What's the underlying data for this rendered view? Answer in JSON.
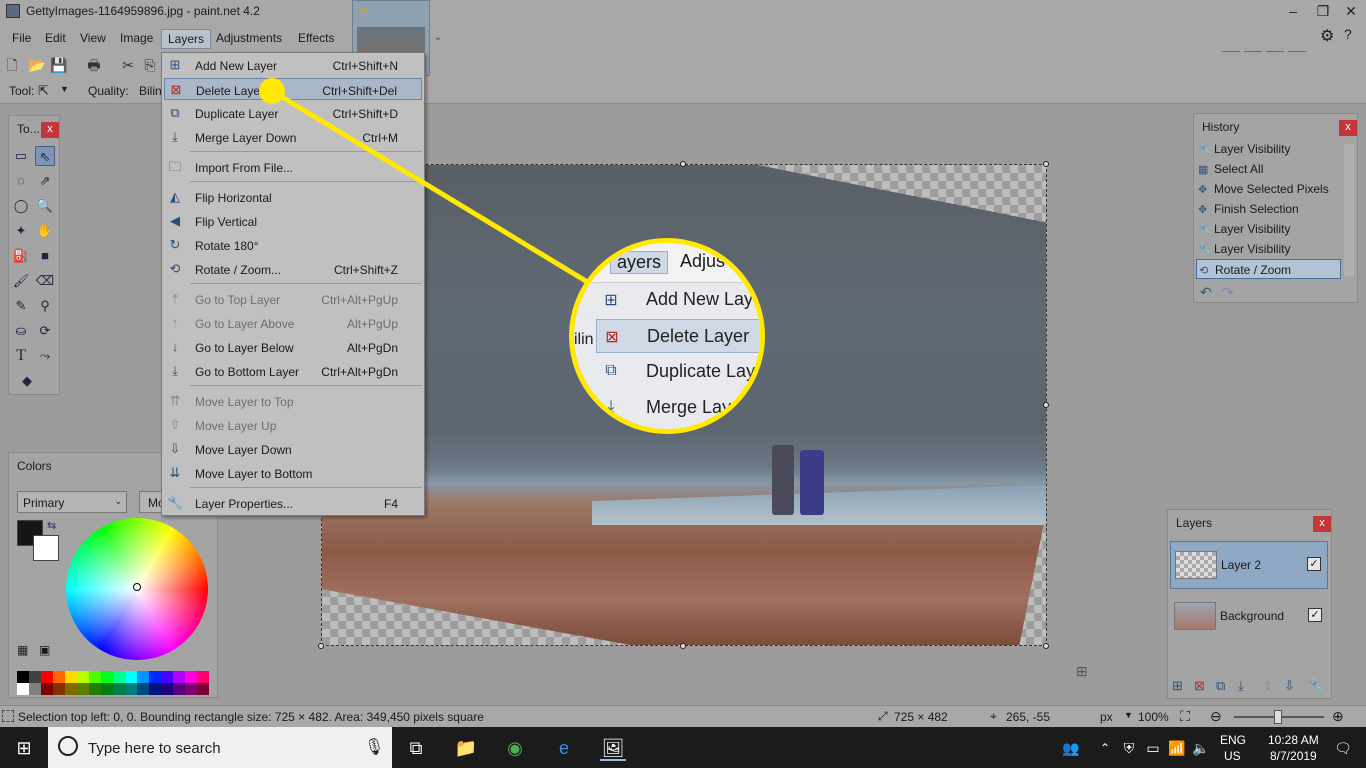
{
  "window": {
    "title": "GettyImages-1164959896.jpg - paint.net 4.2",
    "minimize": "–",
    "maximize": "❐",
    "close": "✕"
  },
  "menubar": {
    "items": [
      "File",
      "Edit",
      "View",
      "Image",
      "Layers",
      "Adjustments",
      "Effects"
    ],
    "active": "Layers"
  },
  "toolbar": {
    "tool_label": "Tool:",
    "quality_label": "Quality:",
    "quality_value": "Bilin"
  },
  "layers_menu": [
    {
      "label": "Add New Layer",
      "shortcut": "Ctrl+Shift+N",
      "enabled": true
    },
    {
      "label": "Delete Layer",
      "shortcut": "Ctrl+Shift+Del",
      "enabled": true,
      "highlighted": true
    },
    {
      "label": "Duplicate Layer",
      "shortcut": "Ctrl+Shift+D",
      "enabled": true
    },
    {
      "label": "Merge Layer Down",
      "shortcut": "Ctrl+M",
      "enabled": true
    },
    {
      "label": "Import From File...",
      "shortcut": "",
      "enabled": true
    },
    {
      "label": "Flip Horizontal",
      "shortcut": "",
      "enabled": true
    },
    {
      "label": "Flip Vertical",
      "shortcut": "",
      "enabled": true
    },
    {
      "label": "Rotate 180°",
      "shortcut": "",
      "enabled": true
    },
    {
      "label": "Rotate / Zoom...",
      "shortcut": "Ctrl+Shift+Z",
      "enabled": true
    },
    {
      "label": "Go to Top Layer",
      "shortcut": "Ctrl+Alt+PgUp",
      "enabled": false
    },
    {
      "label": "Go to Layer Above",
      "shortcut": "Alt+PgUp",
      "enabled": false
    },
    {
      "label": "Go to Layer Below",
      "shortcut": "Alt+PgDn",
      "enabled": true
    },
    {
      "label": "Go to Bottom Layer",
      "shortcut": "Ctrl+Alt+PgDn",
      "enabled": true
    },
    {
      "label": "Move Layer to Top",
      "shortcut": "",
      "enabled": false
    },
    {
      "label": "Move Layer Up",
      "shortcut": "",
      "enabled": false
    },
    {
      "label": "Move Layer Down",
      "shortcut": "",
      "enabled": true
    },
    {
      "label": "Move Layer to Bottom",
      "shortcut": "",
      "enabled": true
    },
    {
      "label": "Layer Properties...",
      "shortcut": "F4",
      "enabled": true
    }
  ],
  "zoom_callout": {
    "menu_header": "ayers",
    "menu_header2": "Adjus",
    "left_text": "ilin",
    "items": [
      "Add New Laye",
      "Delete Layer",
      "Duplicate Laye",
      "Merge Laye"
    ]
  },
  "tools_panel": {
    "title": "To...",
    "close": "x"
  },
  "colors_panel": {
    "title": "Colors",
    "mode": "Primary",
    "more": "Mo"
  },
  "history_panel": {
    "title": "History",
    "close": "x",
    "items": [
      "Layer Visibility",
      "Select All",
      "Move Selected Pixels",
      "Finish Selection",
      "Layer Visibility",
      "Layer Visibility",
      "Rotate / Zoom"
    ],
    "selected": "Rotate / Zoom"
  },
  "layers_panel": {
    "title": "Layers",
    "close": "x",
    "layers": [
      {
        "name": "Layer 2",
        "visible": true,
        "selected": true
      },
      {
        "name": "Background",
        "visible": true,
        "selected": false
      }
    ]
  },
  "status": {
    "text": "Selection top left: 0, 0. Bounding rectangle size: 725 × 482. Area: 349,450 pixels square",
    "size": "725 × 482",
    "cursor": "265, -55",
    "unit": "px",
    "zoom": "100%"
  },
  "taskbar": {
    "search_placeholder": "Type here to search",
    "lang": "ENG",
    "region": "US",
    "time": "10:28 AM",
    "date": "8/7/2019"
  },
  "colors": {
    "highlight": "#ffe900",
    "selection": "#a9b8c8",
    "close_red": "#c4363a"
  }
}
